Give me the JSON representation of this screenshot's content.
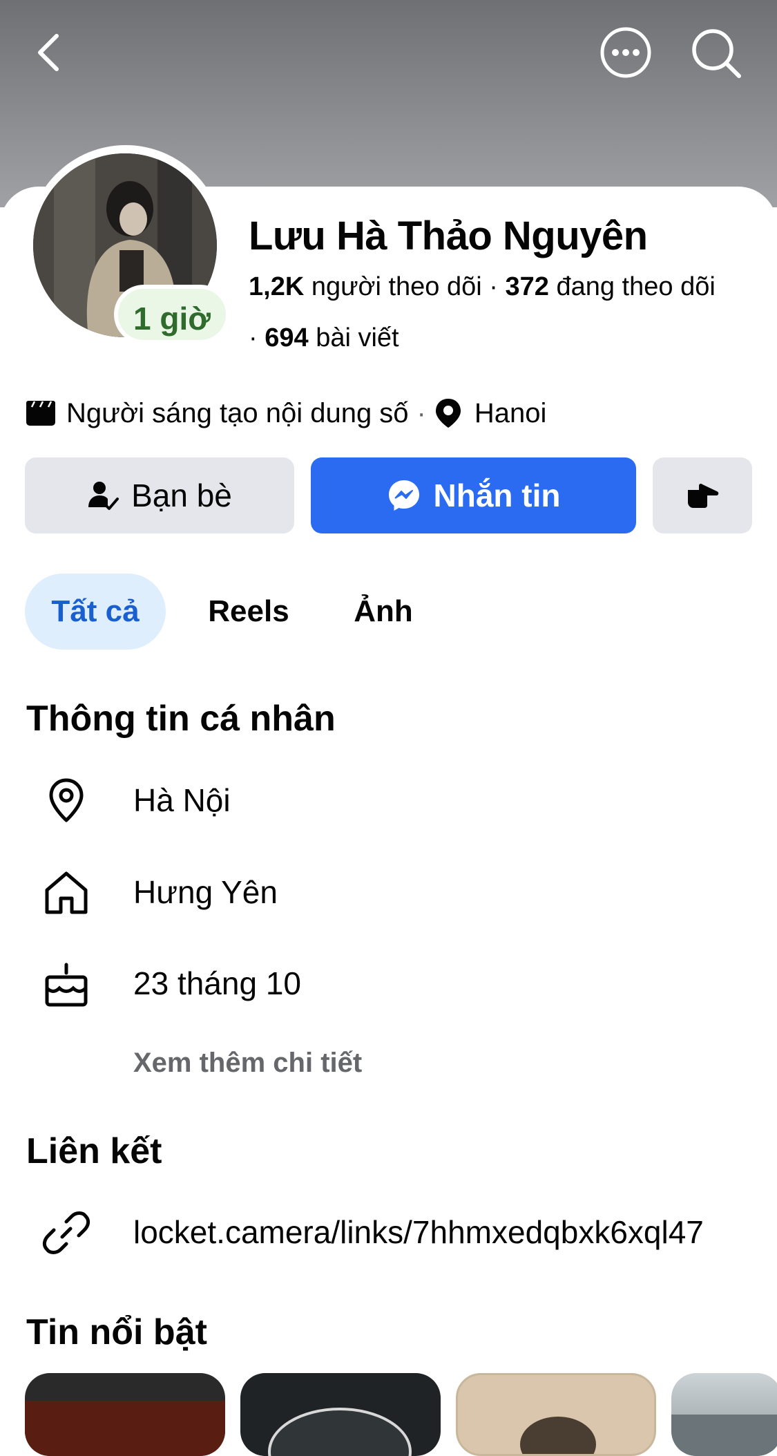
{
  "header": {
    "back_icon": "chevron-left-icon",
    "more_icon": "more-dots-icon",
    "search_icon": "search-icon"
  },
  "profile": {
    "name": "Lưu Hà Thảo Nguyên",
    "status": "1 giờ",
    "followers_count": "1,2K",
    "followers_label": "người theo dõi",
    "following_count": "372",
    "following_label": "đang theo dõi",
    "posts_count": "694",
    "posts_label": "bài viết",
    "category": "Người sáng tạo nội dung số",
    "location": "Hanoi"
  },
  "actions": {
    "friends_label": "Bạn bè",
    "message_label": "Nhắn tin",
    "poke_icon": "poke-hand-icon",
    "accent": "#2a6bf2"
  },
  "tabs": [
    {
      "label": "Tất cả",
      "active": true
    },
    {
      "label": "Reels",
      "active": false
    },
    {
      "label": "Ảnh",
      "active": false
    }
  ],
  "personal_info": {
    "title": "Thông tin cá nhân",
    "items": [
      {
        "icon": "location-pin-icon",
        "text": "Hà Nội"
      },
      {
        "icon": "home-icon",
        "text": "Hưng Yên"
      },
      {
        "icon": "birthday-cake-icon",
        "text": "23 tháng 10"
      }
    ],
    "see_more": "Xem thêm chi tiết"
  },
  "links": {
    "title": "Liên kết",
    "items": [
      {
        "icon": "link-icon",
        "text": "locket.camera/links/7hhmxedqbxk6xql47"
      }
    ]
  },
  "highlights": {
    "title": "Tin nổi bật"
  }
}
